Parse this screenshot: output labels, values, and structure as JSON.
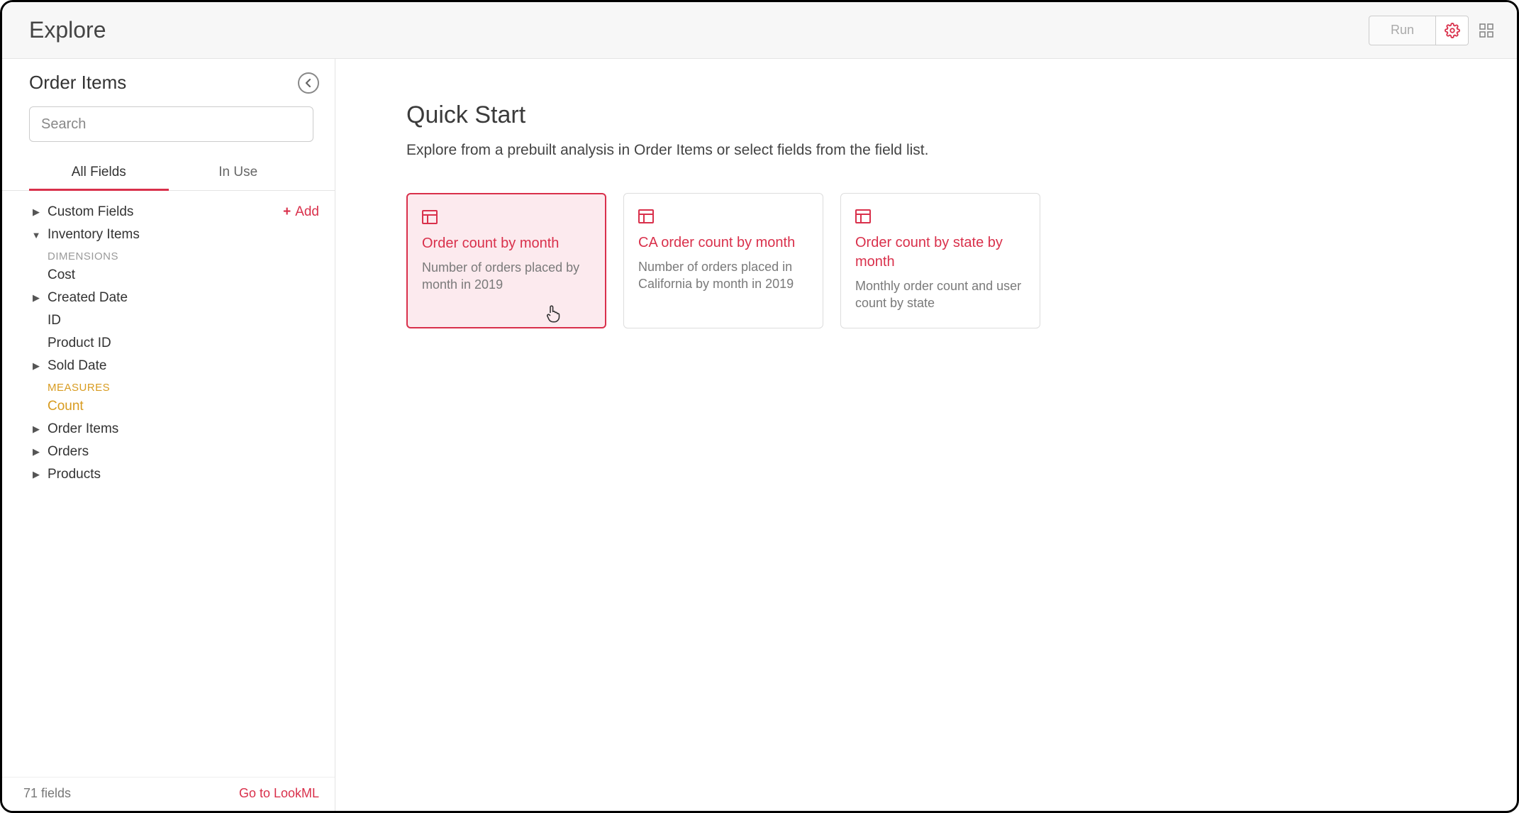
{
  "topbar": {
    "title": "Explore",
    "run_label": "Run"
  },
  "sidebar": {
    "title": "Order Items",
    "search_placeholder": "Search",
    "tabs": {
      "all": "All Fields",
      "in_use": "In Use"
    },
    "custom_fields_label": "Custom Fields",
    "add_label": "Add",
    "groups": {
      "inventory_items": {
        "label": "Inventory Items",
        "dimensions_label": "DIMENSIONS",
        "measures_label": "MEASURES",
        "fields": {
          "cost": "Cost",
          "created_date": "Created Date",
          "id": "ID",
          "product_id": "Product ID",
          "sold_date": "Sold Date"
        },
        "measures": {
          "count": "Count"
        }
      },
      "order_items": "Order Items",
      "orders": "Orders",
      "products": "Products"
    },
    "footer": {
      "field_count": "71 fields",
      "lookml_link": "Go to LookML"
    }
  },
  "main": {
    "title": "Quick Start",
    "subtitle": "Explore from a prebuilt analysis in Order Items or select fields from the field list.",
    "cards": [
      {
        "title": "Order count by month",
        "desc": "Number of orders placed by month in 2019"
      },
      {
        "title": "CA order count by month",
        "desc": "Number of orders placed in California by month in 2019"
      },
      {
        "title": "Order count by state by month",
        "desc": "Monthly order count and user count by state"
      }
    ]
  }
}
